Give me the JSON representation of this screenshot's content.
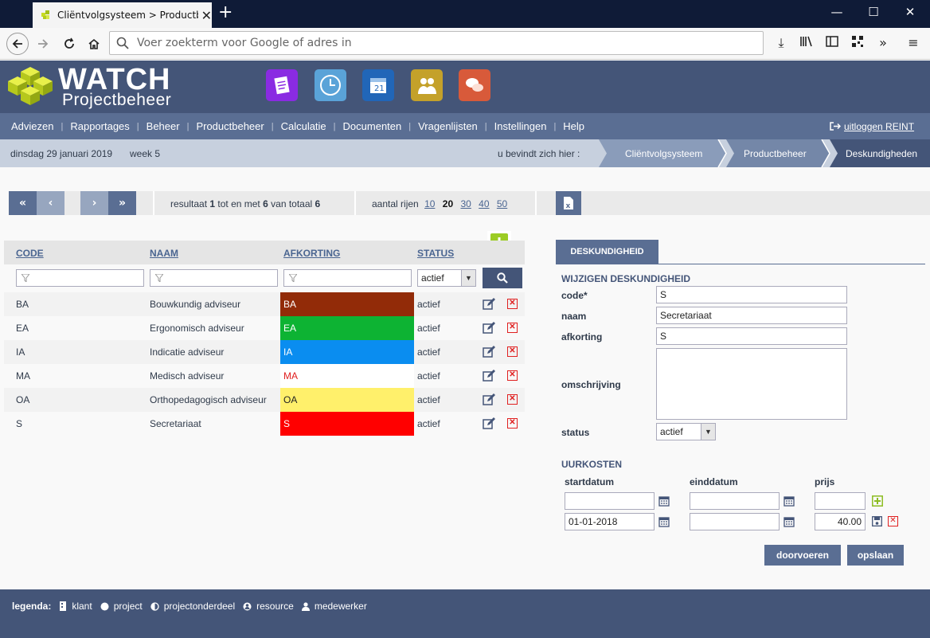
{
  "browser": {
    "tab_title": "Cliëntvolgsysteem > Productbeheer",
    "address_placeholder": "Voer zoekterm voor Google of adres in"
  },
  "app": {
    "logo_title": "WATCH",
    "logo_subtitle": "Projectbeheer"
  },
  "menu": {
    "items": [
      "Adviezen",
      "Rapportages",
      "Beheer",
      "Productbeheer",
      "Calculatie",
      "Documenten",
      "Vragenlijsten",
      "Instellingen",
      "Help"
    ],
    "logout": "uitloggen REINT"
  },
  "breadcrumb": {
    "date": "dinsdag 29 januari 2019",
    "week": "week 5",
    "here_label": "u bevindt zich hier :",
    "items": [
      "Cliëntvolgsysteem",
      "Productbeheer",
      "Deskundigheden"
    ]
  },
  "pager": {
    "first": "«",
    "prev": "‹",
    "next": "›",
    "last": "»",
    "result_prefix": "resultaat",
    "result_from": "1",
    "result_mid": "tot en met",
    "result_to": "6",
    "result_of": "van totaal",
    "result_total": "6",
    "rows_label": "aantal rijen",
    "row_options": [
      "10",
      "20",
      "30",
      "40",
      "50"
    ],
    "row_selected": "20"
  },
  "table": {
    "headers": {
      "code": "CODE",
      "naam": "NAAM",
      "afkorting": "AFKORTING",
      "status": "STATUS"
    },
    "status_filter": "actief",
    "rows": [
      {
        "code": "BA",
        "naam": "Bouwkundig adviseur",
        "afkorting": "BA",
        "status": "actief",
        "bg": "#922b08",
        "fg": "#ffffff"
      },
      {
        "code": "EA",
        "naam": "Ergonomisch adviseur",
        "afkorting": "EA",
        "status": "actief",
        "bg": "#0db333",
        "fg": "#ffffff"
      },
      {
        "code": "IA",
        "naam": "Indicatie adviseur",
        "afkorting": "IA",
        "status": "actief",
        "bg": "#0a8df0",
        "fg": "#ffffff"
      },
      {
        "code": "MA",
        "naam": "Medisch adviseur",
        "afkorting": "MA",
        "status": "actief",
        "bg": "#ffffff",
        "fg": "#e02020"
      },
      {
        "code": "OA",
        "naam": "Orthopedagogisch adviseur",
        "afkorting": "OA",
        "status": "actief",
        "bg": "#fff06b",
        "fg": "#222222"
      },
      {
        "code": "S",
        "naam": "Secretariaat",
        "afkorting": "S",
        "status": "actief",
        "bg": "#ff0000",
        "fg": "#ffffff"
      }
    ]
  },
  "form": {
    "panel_title": "DESKUNDIGHEID",
    "section_title": "WIJZIGEN DESKUNDIGHEID",
    "code_label": "code*",
    "code_value": "S",
    "naam_label": "naam",
    "naam_value": "Secretariaat",
    "afkorting_label": "afkorting",
    "afkorting_value": "S",
    "omschrijving_label": "omschrijving",
    "omschrijving_value": "",
    "status_label": "status",
    "status_value": "actief",
    "uurkosten_title": "UURKOSTEN",
    "col_start": "startdatum",
    "col_end": "einddatum",
    "col_price": "prijs",
    "rates": [
      {
        "start": "",
        "end": "",
        "price": ""
      },
      {
        "start": "01-01-2018",
        "end": "",
        "price": "40.00"
      }
    ],
    "btn_apply": "doorvoeren",
    "btn_save": "opslaan"
  },
  "footer": {
    "legend_label": "legenda:",
    "items": [
      "klant",
      "project",
      "projectonderdeel",
      "resource",
      "medewerker"
    ]
  }
}
